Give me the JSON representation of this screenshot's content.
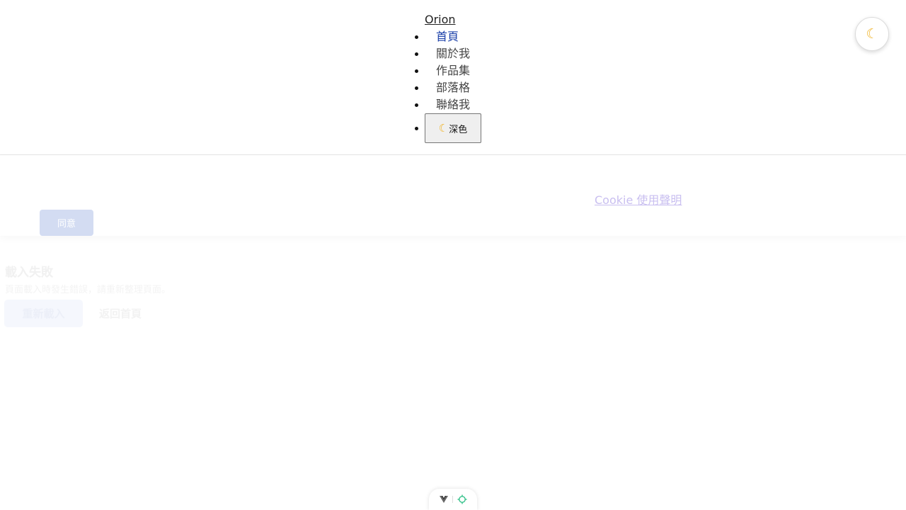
{
  "header": {
    "brand": "Orion",
    "nav": [
      {
        "label": "首頁",
        "active": true
      },
      {
        "label": "關於我",
        "active": false
      },
      {
        "label": "作品集",
        "active": false
      },
      {
        "label": "部落格",
        "active": false
      },
      {
        "label": "聯絡我",
        "active": false
      }
    ],
    "theme_toggle_label": "深色",
    "theme_toggle_icon": "moon-icon"
  },
  "floating_theme_button": {
    "icon": "moon-icon"
  },
  "cookie_banner": {
    "link_text": "Cookie 使用聲明",
    "agree_label": "同意"
  },
  "error_panel": {
    "title": "載入失敗",
    "message": "頁面載入時發生錯誤，請重新整理頁面。",
    "reload_label": "重新載入",
    "home_label": "返回首頁"
  },
  "devtools": {
    "icons": [
      "vue-logo-icon",
      "crosshair-icon"
    ]
  },
  "colors": {
    "active_nav": "#1a3fa8",
    "moon": "#f0b429",
    "cookie_link": "#c9bff0",
    "agree_button": "#d3dcf2"
  }
}
